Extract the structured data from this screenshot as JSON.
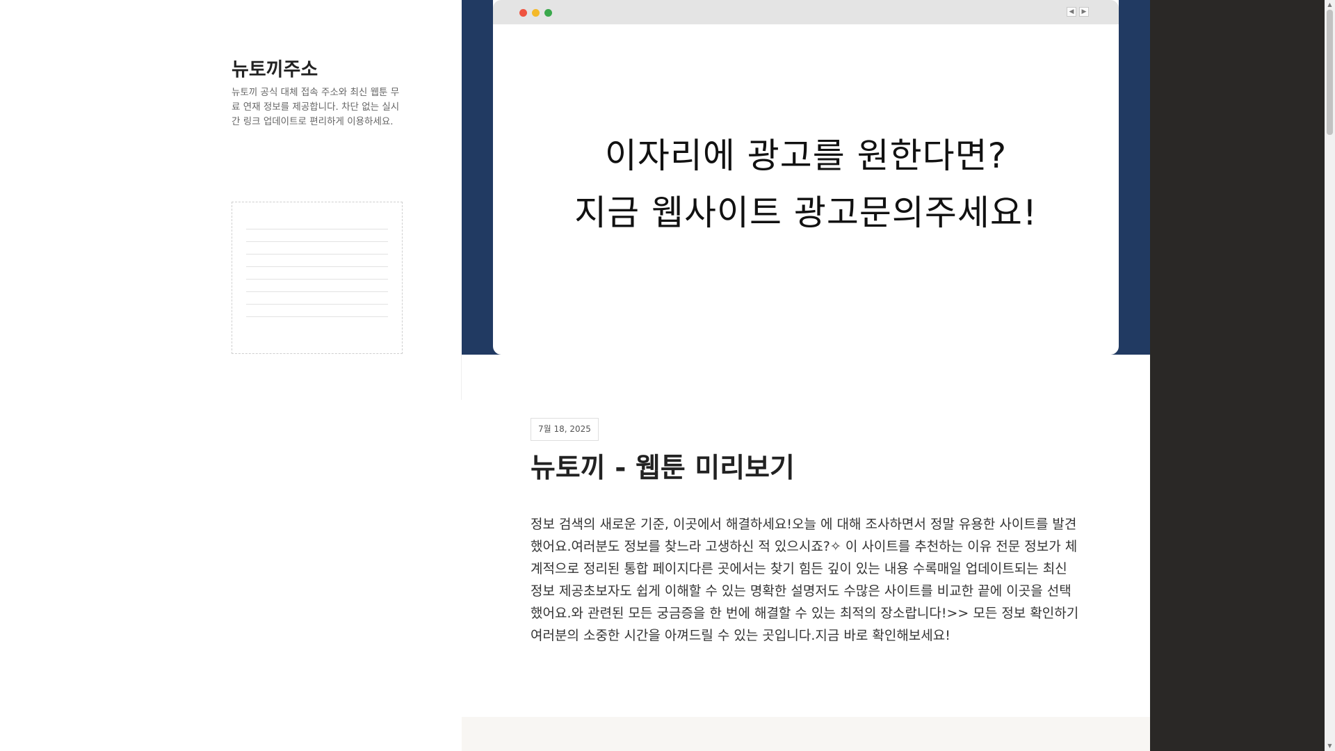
{
  "site": {
    "title": "뉴토끼주소",
    "description": "뉴토끼 공식 대체 접속 주소와 최신 웹툰 무료 연재 정보를 제공합니다. 차단 없는 실시간 링크 업데이트로 편리하게 이용하세요."
  },
  "hero": {
    "ad_line1": "이자리에 광고를 원한다면?",
    "ad_line2": "지금 웹사이트 광고문의주세요!",
    "prev_icon": "◀",
    "next_icon": "▶"
  },
  "post": {
    "date": "7월 18, 2025",
    "title": "뉴토끼 - 웹툰 미리보기",
    "body": "정보 검색의 새로운 기준, 이곳에서 해결하세요!오늘 에 대해 조사하면서 정말 유용한 사이트를 발견했어요.여러분도 정보를 찾느라 고생하신 적 있으시죠?✧ 이 사이트를 추천하는 이유 전문 정보가 체계적으로 정리된 통합 페이지다른 곳에서는 찾기 힘든 깊이 있는 내용 수록매일 업데이트되는 최신 정보 제공초보자도 쉽게 이해할 수 있는 명확한 설명저도 수많은 사이트를 비교한 끝에 이곳을 선택했어요.와 관련된 모든 궁금증을 한 번에 해결할 수 있는 최적의 장소랍니다!>> 모든 정보 확인하기여러분의 소중한 시간을 아껴드릴 수 있는 곳입니다.지금 바로 확인해보세요!"
  },
  "scrollbar": {
    "up_icon": "▲",
    "down_icon": "▼"
  },
  "colors": {
    "hero_background": "#213a62",
    "right_panel": "#2a2826",
    "dot_red": "#ef5340",
    "dot_yellow": "#f4b929",
    "dot_green": "#3aa84c"
  }
}
